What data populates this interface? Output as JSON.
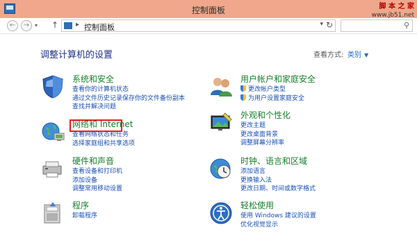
{
  "window": {
    "title": "控制面板"
  },
  "watermark": {
    "line1": "脚 本 之 家",
    "line2": "www.jb51.net"
  },
  "address_bar": {
    "crumb": "控制面板"
  },
  "heading": "调整计算机的设置",
  "view": {
    "label": "查看方式:",
    "value": "类别"
  },
  "categories": [
    {
      "title": "系统和安全",
      "icon": "system-security-icon",
      "links": [
        "查看你的计算机状态",
        "通过文件历史记录保存你的文件备份副本",
        "查找并解决问题"
      ]
    },
    {
      "title": "网络和 Internet",
      "icon": "network-icon",
      "links": [
        "查看网络状态和任务",
        "选择家庭组和共享选项"
      ]
    },
    {
      "title": "硬件和声音",
      "icon": "hardware-sound-icon",
      "links": [
        "查看设备和打印机",
        "添加设备",
        "调整常用移动设置"
      ]
    },
    {
      "title": "程序",
      "icon": "programs-icon",
      "links": [
        "卸载程序"
      ]
    },
    {
      "title": "用户帐户和家庭安全",
      "icon": "user-accounts-icon",
      "links": [
        "更改帐户类型",
        "为用户设置家庭安全"
      ]
    },
    {
      "title": "外观和个性化",
      "icon": "appearance-icon",
      "links": [
        "更改主题",
        "更改桌面背景",
        "调整屏幕分辨率"
      ]
    },
    {
      "title": "时钟、语言和区域",
      "icon": "clock-language-icon",
      "links": [
        "添加语言",
        "更换输入法",
        "更改日期、时间或数字格式"
      ]
    },
    {
      "title": "轻松使用",
      "icon": "ease-of-access-icon",
      "links": [
        "使用 Windows 建议的设置",
        "优化视觉显示"
      ]
    }
  ]
}
